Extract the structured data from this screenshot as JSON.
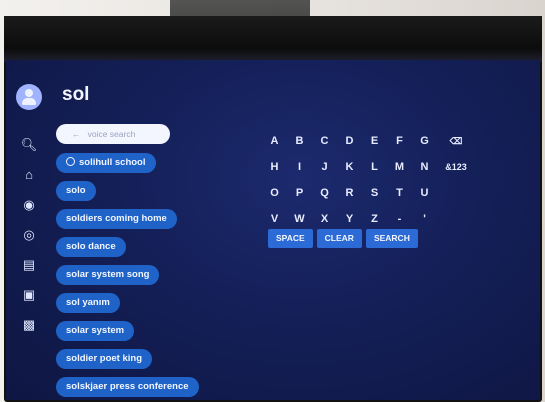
{
  "search": {
    "query": "sol",
    "mic_hint": "voice search"
  },
  "rail_icons": [
    "search-icon",
    "home-icon",
    "controller-icon",
    "target-icon",
    "news-icon",
    "tv-icon",
    "library-icon"
  ],
  "suggestions": [
    "solihull school",
    "solo",
    "soldiers coming home",
    "solo dance",
    "solar system song",
    "sol yanım",
    "solar system",
    "soldier poet king",
    "solskjaer press conference"
  ],
  "keyboard": {
    "rows": [
      [
        "A",
        "B",
        "C",
        "D",
        "E",
        "F",
        "G",
        "⌫"
      ],
      [
        "H",
        "I",
        "J",
        "K",
        "L",
        "M",
        "N",
        "&123"
      ],
      [
        "O",
        "P",
        "Q",
        "R",
        "S",
        "T",
        "U"
      ],
      [
        "V",
        "W",
        "X",
        "Y",
        "Z",
        "-",
        "'"
      ]
    ],
    "actions": [
      "SPACE",
      "CLEAR",
      "SEARCH"
    ]
  }
}
